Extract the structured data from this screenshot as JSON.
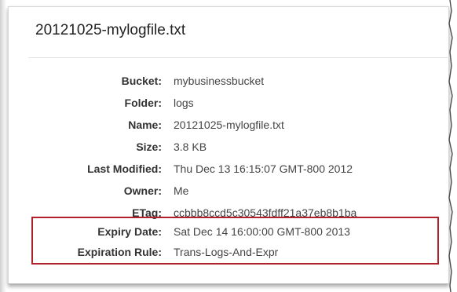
{
  "object": {
    "title": "20121025-mylogfile.txt"
  },
  "properties": [
    {
      "label": "Bucket:",
      "value": "mybusinessbucket"
    },
    {
      "label": "Folder:",
      "value": "logs"
    },
    {
      "label": "Name:",
      "value": "20121025-mylogfile.txt"
    },
    {
      "label": "Size:",
      "value": "3.8 KB"
    },
    {
      "label": "Last Modified:",
      "value": "Thu Dec 13 16:15:07 GMT-800 2012"
    },
    {
      "label": "Owner:",
      "value": "Me"
    },
    {
      "label": "ETag:",
      "value": "ccbbb8ccd5c30543fdff21a37eb8b1ba"
    },
    {
      "label": "Expiry Date:",
      "value": "Sat Dec 14 16:00:00 GMT-800 2013"
    },
    {
      "label": "Expiration Rule:",
      "value": "Trans-Logs-And-Expr"
    }
  ],
  "colors": {
    "highlight_border": "#b2202c",
    "label_text": "#333333",
    "value_text": "#444444"
  }
}
